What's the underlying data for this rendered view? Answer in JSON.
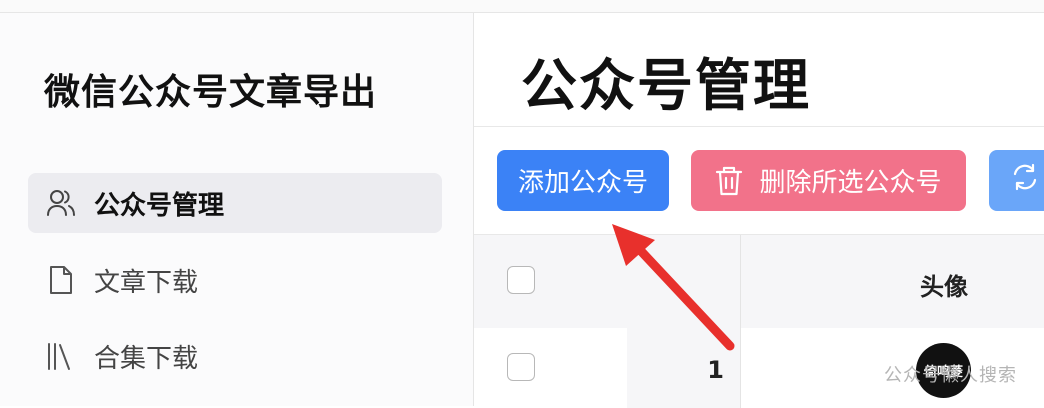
{
  "sidebar": {
    "app_title": "微信公众号文章导出",
    "items": [
      {
        "label": "公众号管理",
        "icon": "users-icon",
        "active": true
      },
      {
        "label": "文章下载",
        "icon": "file-icon",
        "active": false
      },
      {
        "label": "合集下载",
        "icon": "library-icon",
        "active": false
      }
    ]
  },
  "main": {
    "page_title": "公众号管理",
    "toolbar": {
      "add_label": "添加公众号",
      "delete_label": "删除所选公众号",
      "sync_icon": "refresh-icon"
    },
    "table": {
      "headers": {
        "avatar": "头像"
      },
      "rows": [
        {
          "index": "1"
        }
      ]
    }
  },
  "watermark": {
    "avatar_text": "倚鸣菱",
    "text": "公众号懒人搜索"
  },
  "colors": {
    "primary": "#3b82f6",
    "danger": "#f2728a",
    "arrow": "#e8302c"
  }
}
